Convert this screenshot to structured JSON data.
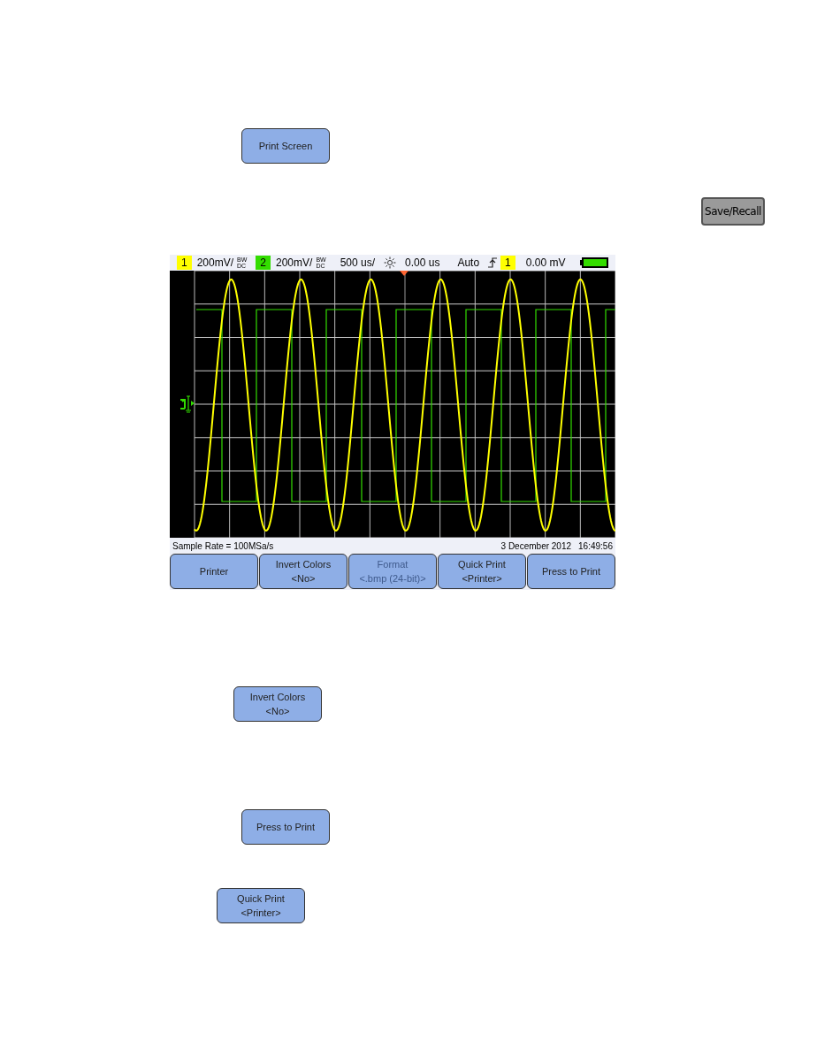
{
  "print_screen_button": {
    "label": "Print Screen"
  },
  "save_recall_key": {
    "label": "Save/Recall"
  },
  "scope": {
    "header": {
      "channels": [
        {
          "number": "1",
          "color": "#ffff00",
          "scale": "200mV/",
          "bw": "BW",
          "coupling": "DC"
        },
        {
          "number": "2",
          "color": "#33dd00",
          "scale": "200mV/",
          "bw": "BW",
          "coupling": "DC"
        }
      ],
      "timebase": "500 us/",
      "delay": "0.00 us",
      "trigger_mode": "Auto",
      "trigger_source": {
        "number": "1",
        "color": "#ffff00"
      },
      "trigger_level": "0.00 mV",
      "battery": {
        "level": 1
      }
    },
    "status": {
      "sample_rate": "Sample Rate = 100MSa/s",
      "date": "3 December 2012",
      "time": "16:49:56"
    },
    "softkeys": [
      {
        "label": "Printer",
        "disabled": false
      },
      {
        "label": "Invert Colors",
        "value": "<No>",
        "disabled": false
      },
      {
        "label": "Format",
        "value": "<.bmp (24-bit)>",
        "disabled": true
      },
      {
        "label": "Quick Print",
        "value": "<Printer>",
        "disabled": false
      },
      {
        "label": "Press to Print",
        "disabled": false
      }
    ]
  },
  "standalone_buttons": [
    {
      "label": "Invert Colors",
      "value": "<No>"
    },
    {
      "label": "Press to Print"
    },
    {
      "label": "Quick Print",
      "value": "<Printer>"
    }
  ]
}
